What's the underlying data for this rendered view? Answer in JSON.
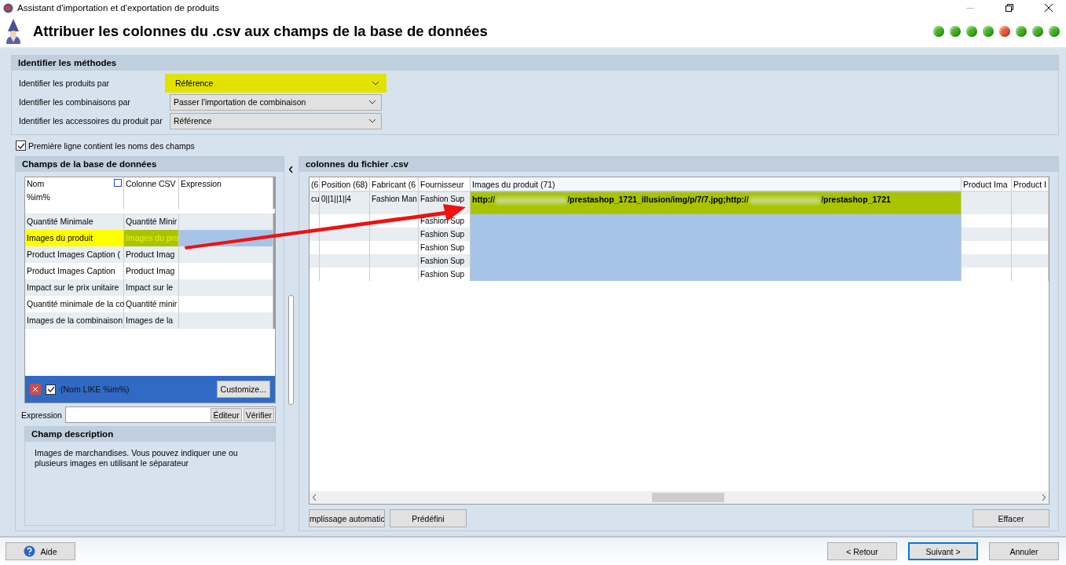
{
  "window": {
    "title": "Assistant d'importation et d'exportation de produits"
  },
  "header": {
    "title": "Attribuer les colonnes du .csv aux champs de la base de données",
    "steps": [
      {
        "color": "#3fb31f"
      },
      {
        "color": "#3fb31f"
      },
      {
        "color": "#3fb31f"
      },
      {
        "color": "#3fb31f"
      },
      {
        "color": "#f0582e"
      },
      {
        "color": "#3fb31f"
      },
      {
        "color": "#3fb31f"
      },
      {
        "color": "#3fb31f"
      }
    ]
  },
  "methods": {
    "title": "Identifier les méthodes",
    "rows": [
      {
        "label": "Identifier les produits par",
        "value": "Référence",
        "highlighted": true
      },
      {
        "label": "Identifier les combinaisons par",
        "value": "Passer l'importation de combinaison",
        "highlighted": false
      },
      {
        "label": "Identifier les accessoires du produit par",
        "value": "Référence",
        "highlighted": false
      }
    ]
  },
  "first_line_names": {
    "label": "Première ligne contient les noms des champs",
    "checked": true
  },
  "db_fields": {
    "title": "Champs de la base de données",
    "columns": [
      "Nom",
      "Colonne CSV",
      "Expression"
    ],
    "filter": "%im%",
    "rows": [
      {
        "name": "Quantité Minimale",
        "csv": "Quantité Minir",
        "selected": false
      },
      {
        "name": "Images du produit",
        "csv": "Images du pro",
        "selected": true
      },
      {
        "name": "Product Images Caption (",
        "csv": "Product Imag",
        "selected": false
      },
      {
        "name": "Product Images Caption",
        "csv": "Product Imag",
        "selected": false
      },
      {
        "name": "Impact sur le prix unitaire",
        "csv": "Impact sur le",
        "selected": false
      },
      {
        "name": "Quantité minimale de la co",
        "csv": "Quantité minir",
        "selected": false
      },
      {
        "name": "Images de la combinaison",
        "csv": "Images de la",
        "selected": false
      }
    ],
    "filter_bar": {
      "text": "(Nom LIKE %im%)",
      "checked": true,
      "button": "Customize..."
    },
    "expression": {
      "label": "Expression",
      "buttons": [
        "Éditeur",
        "Vérifier"
      ]
    },
    "description": {
      "title": "Champ description",
      "text": "Images de marchandises. Vous pouvez indiquer une ou plusieurs images en utilisant le séparateur"
    }
  },
  "csv": {
    "title": "colonnes du fichier .csv",
    "columns": [
      {
        "label": "(6",
        "selected": false
      },
      {
        "label": "Position (68)",
        "selected": false
      },
      {
        "label": "Fabricant (6",
        "selected": false
      },
      {
        "label": "Fournisseur",
        "selected": false
      },
      {
        "label": "Images du produit (71)",
        "selected": true
      },
      {
        "label": "Product Ima",
        "selected": false
      },
      {
        "label": "Product I",
        "selected": false
      }
    ],
    "rows": [
      [
        "cu",
        "0||1||1||4",
        "Fashion Man",
        "Fashion Sup",
        {
          "parts": [
            "http://",
            "/prestashop_1721_illusion/img/p/7/7.jpg;http://",
            "/prestashop_1721"
          ]
        },
        "",
        ""
      ],
      [
        "",
        "",
        "",
        "Fashion Sup",
        "",
        "",
        ""
      ],
      [
        "",
        "",
        "",
        "Fashion Sup",
        "",
        "",
        ""
      ],
      [
        "",
        "",
        "",
        "Fashion Sup",
        "",
        "",
        ""
      ],
      [
        "",
        "",
        "",
        "Fashion Sup",
        "",
        "",
        ""
      ],
      [
        "",
        "",
        "",
        "Fashion Sup",
        "",
        "",
        ""
      ]
    ],
    "buttons": [
      "mplissage automatic",
      "Prédéfini"
    ],
    "clear_button": "Effacer"
  },
  "footer": {
    "help": "Aide",
    "buttons": [
      {
        "label": "< Retour",
        "default": false
      },
      {
        "label": "Suivant >",
        "default": true
      },
      {
        "label": "Annuler",
        "default": false
      }
    ]
  }
}
